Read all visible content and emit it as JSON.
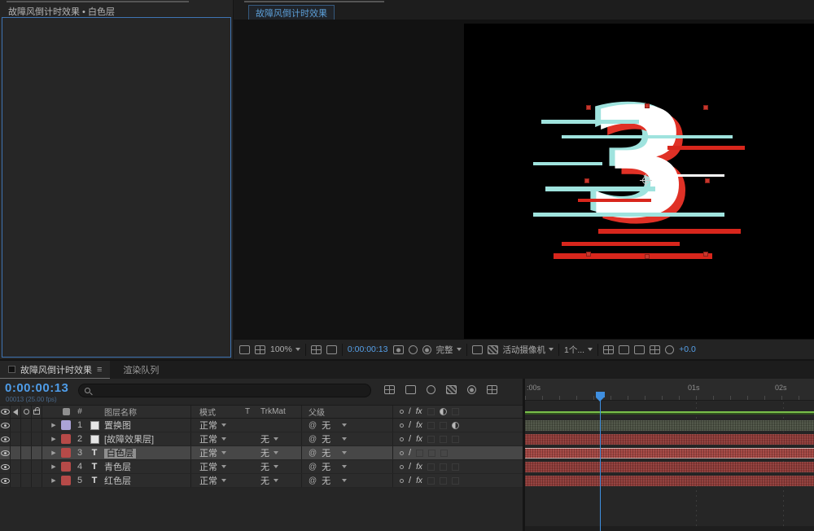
{
  "icons": {
    "expand_arrow": "▶",
    "text_layer": "T",
    "pickwhip": "@",
    "quality_switch": "/",
    "fx_switch": "fx",
    "menu": "≡",
    "number_sign": "#"
  },
  "colors": {
    "accent_blue": "#4e9ce8",
    "cache_green": "#79bf4a",
    "playhead_blue": "#3f8fe0",
    "focus_border_blue": "#3f74b3"
  },
  "effect_controls": {
    "tab_title": "故障风倒计时效果 • 白色层"
  },
  "composition": {
    "tab_title": "故障风倒计时效果",
    "glitch_digit": "3",
    "toolbar": {
      "zoom": "100%",
      "timecode": "0:00:00:13",
      "resolution": "完整",
      "camera_view": "活动摄像机",
      "view_layout": "1个...",
      "exposure": "+0.0"
    }
  },
  "timeline": {
    "tabs": [
      {
        "label": "故障风倒计时效果"
      },
      {
        "label": "渲染队列"
      }
    ],
    "timecode": "0:00:00:13",
    "frame_info": "00013 (25.00 fps)",
    "columns": {
      "layer_name": "图层名称",
      "mode": "模式",
      "trkmat_t": "T",
      "trkmat": "TrkMat",
      "parent": "父级"
    },
    "ruler": [
      ":00s",
      "01s",
      "02s"
    ],
    "layers": [
      {
        "num": "1",
        "name": "置换图",
        "mode": "正常",
        "trkmat": "",
        "parent": "无",
        "label_color": "#aba3d7",
        "bar_color": "#4b5143"
      },
      {
        "num": "2",
        "name": "[故障效果层]",
        "mode": "正常",
        "trkmat": "无",
        "parent": "无",
        "label_color": "#b64a48",
        "bar_color": "#8e3b38"
      },
      {
        "num": "3",
        "name": "白色层",
        "mode": "正常",
        "trkmat": "无",
        "parent": "无",
        "label_color": "#b64a48",
        "bar_color": "#a24541"
      },
      {
        "num": "4",
        "name": "青色层",
        "mode": "正常",
        "trkmat": "无",
        "parent": "无",
        "label_color": "#b64a48",
        "bar_color": "#8e3b38"
      },
      {
        "num": "5",
        "name": "红色层",
        "mode": "正常",
        "trkmat": "无",
        "parent": "无",
        "label_color": "#b64a48",
        "bar_color": "#8e3b38"
      }
    ]
  }
}
